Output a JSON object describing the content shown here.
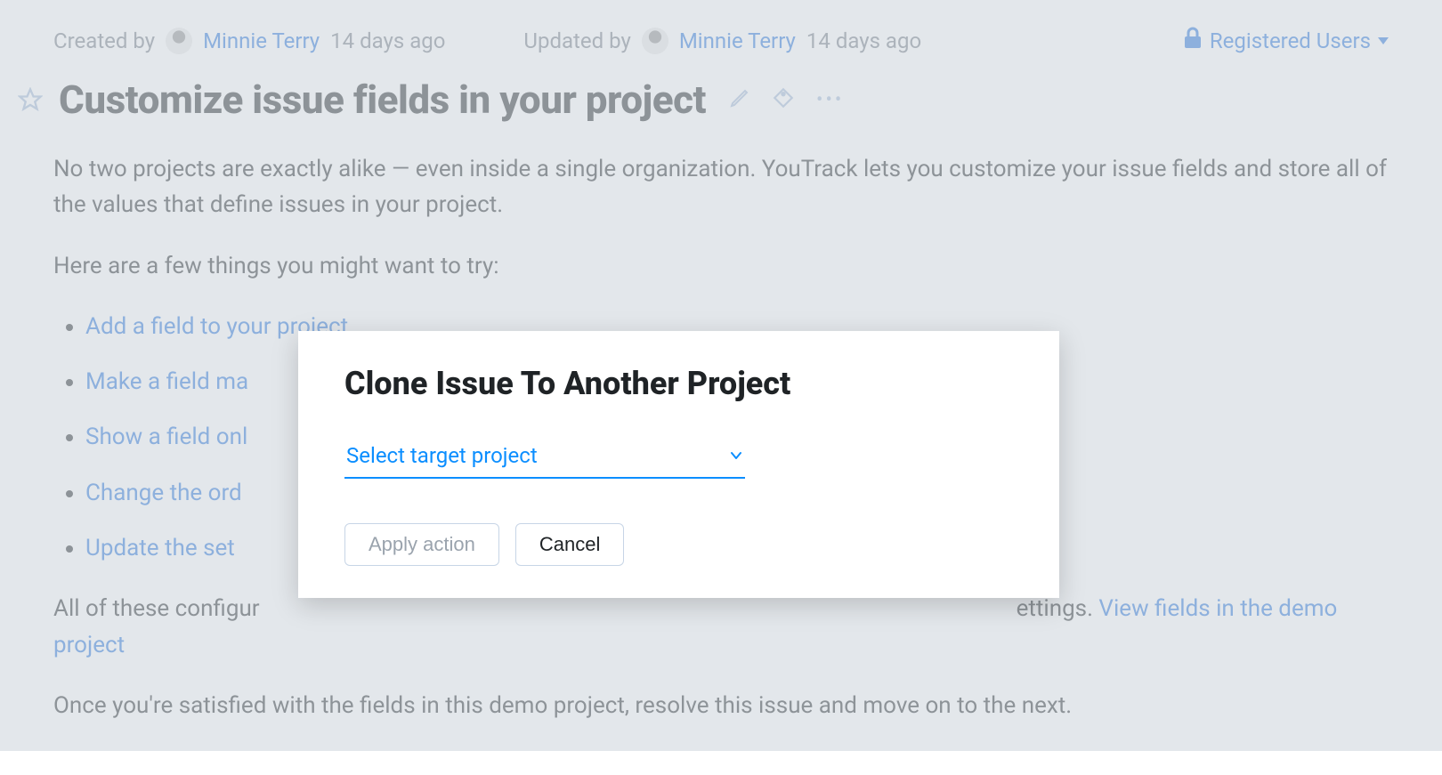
{
  "meta": {
    "created_label": "Created by",
    "created_user": "Minnie Terry",
    "created_time": "14 days ago",
    "updated_label": "Updated by",
    "updated_user": "Minnie Terry",
    "updated_time": "14 days ago",
    "visibility": "Registered Users"
  },
  "title": "Customize issue fields in your project",
  "body": {
    "p1": "No two projects are exactly alike — even inside a single organization. YouTrack lets you customize your issue fields and store all of the values that define issues in your project.",
    "p2": "Here are a few things you might want to try:",
    "links": {
      "l1": "Add a field to your project",
      "l2": "Make a field ma",
      "l3": "Show a field onl",
      "l4": "Change the ord",
      "l5": "Update the set"
    },
    "p3_prefix": "All of these configur",
    "p3_suffix": "ettings. ",
    "p3_link": "View fields in the demo project",
    "p4": "Once you're satisfied with the fields in this demo project, resolve this issue and move on to the next."
  },
  "dialog": {
    "title": "Clone Issue To Another Project",
    "select_placeholder": "Select target project",
    "apply": "Apply action",
    "cancel": "Cancel"
  }
}
